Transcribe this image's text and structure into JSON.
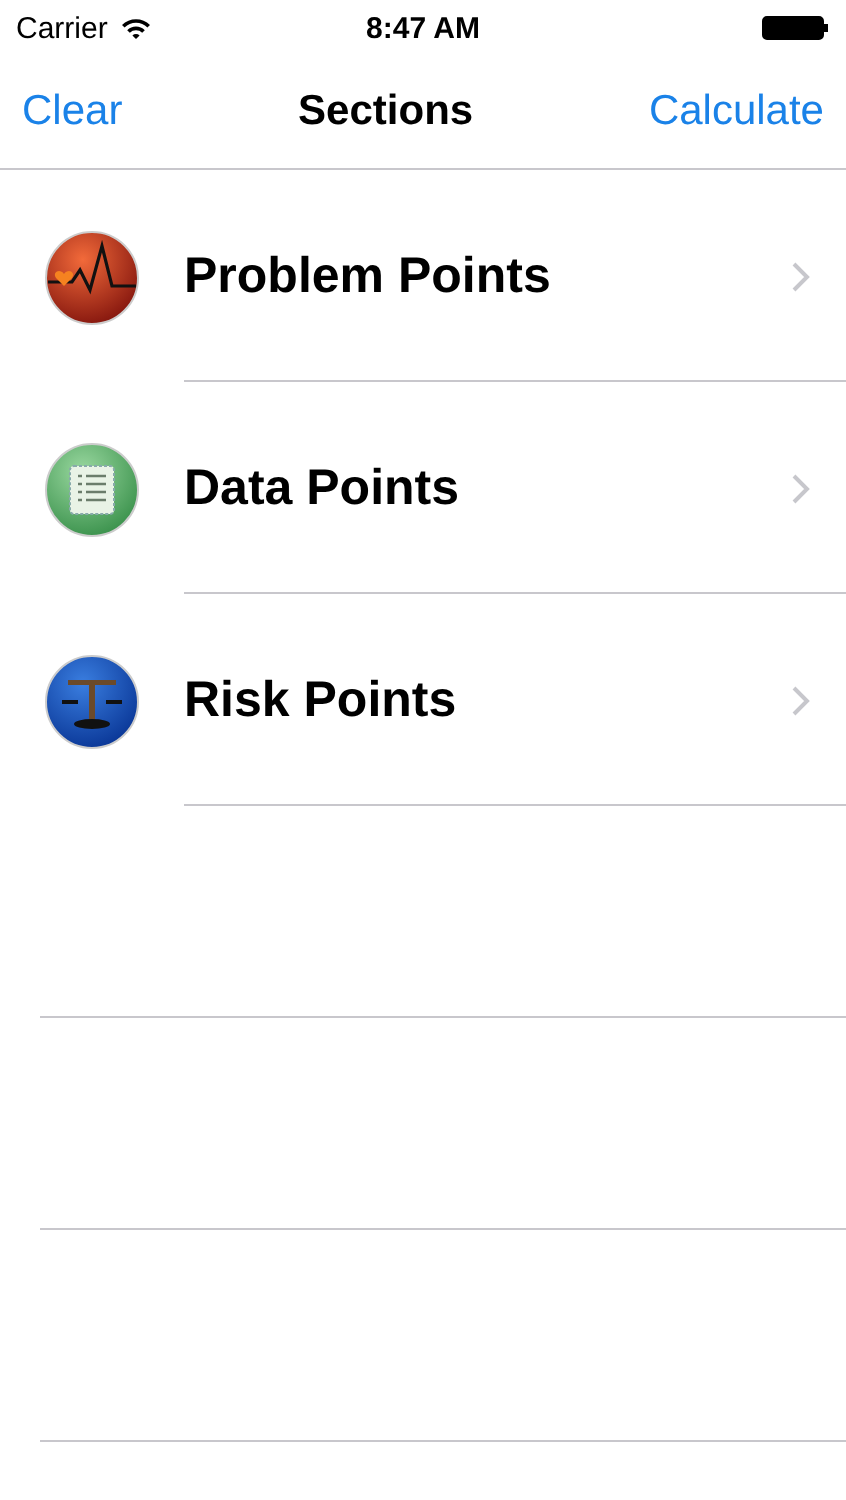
{
  "status_bar": {
    "carrier": "Carrier",
    "time": "8:47 AM"
  },
  "nav_bar": {
    "left_button": "Clear",
    "title": "Sections",
    "right_button": "Calculate"
  },
  "sections": [
    {
      "label": "Problem Points",
      "kind": "pulse"
    },
    {
      "label": "Data Points",
      "kind": "list"
    },
    {
      "label": "Risk Points",
      "kind": "scales"
    }
  ]
}
